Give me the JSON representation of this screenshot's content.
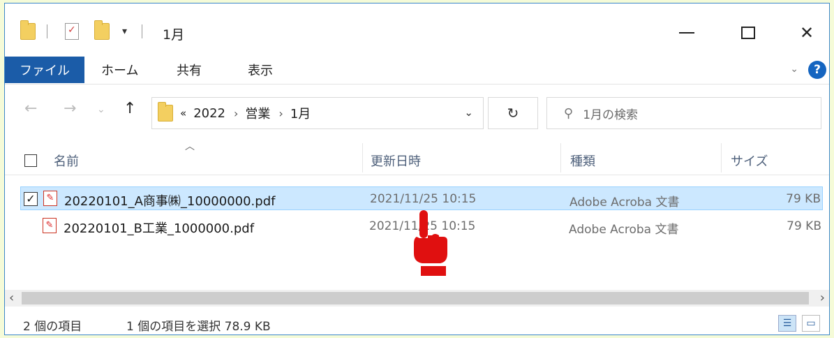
{
  "window": {
    "title": "1月"
  },
  "ribbon": {
    "tabs": [
      "ファイル",
      "ホーム",
      "共有",
      "表示"
    ]
  },
  "nav": {
    "breadcrumb_prefix": "«",
    "breadcrumb": [
      "2022",
      "営業",
      "1月"
    ],
    "search_placeholder": "1月の検索"
  },
  "columns": {
    "name": "名前",
    "date": "更新日時",
    "type": "種類",
    "size": "サイズ"
  },
  "files": [
    {
      "name": "20220101_A商事㈱_10000000.pdf",
      "date": "2021/11/25 10:15",
      "type": "Adobe Acroba 文書",
      "size": "79 KB",
      "selected": true
    },
    {
      "name": "20220101_B工業_1000000.pdf",
      "date": "2021/11/25 10:15",
      "type": "Adobe Acroba 文書",
      "size": "79 KB",
      "selected": false
    }
  ],
  "status": {
    "items": "2 個の項目",
    "selected": "1 個の項目を選択 78.9 KB"
  },
  "colors": {
    "accent": "#1b5ca8",
    "selection": "#cce8ff",
    "background": "#f5fbd8",
    "cursor": "#e01010"
  }
}
